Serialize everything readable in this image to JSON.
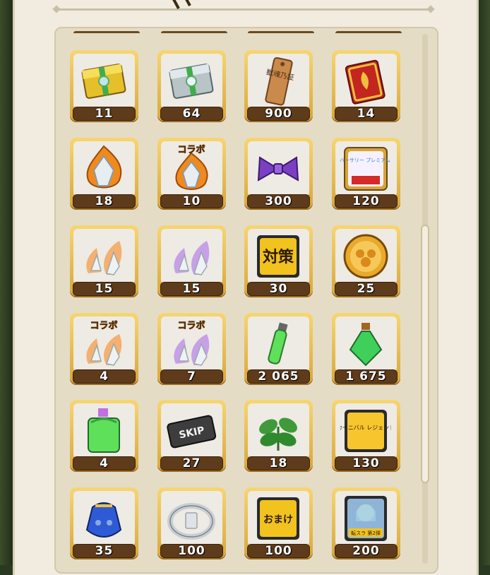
{
  "items": [
    {
      "name": "gold-treasure-chest-icon",
      "count": "11"
    },
    {
      "name": "silver-treasure-chest-icon",
      "count": "64"
    },
    {
      "name": "wooden-tag-icon",
      "count": "900",
      "label": "獣魂乃証"
    },
    {
      "name": "red-book-icon",
      "count": "14"
    },
    {
      "name": "orange-flame-crystal-icon",
      "count": "18"
    },
    {
      "name": "collab-orange-flame-crystal-icon",
      "count": "10",
      "label": "コラボ"
    },
    {
      "name": "purple-bow-icon",
      "count": "300"
    },
    {
      "name": "anniversary-premium-ticket-icon",
      "count": "120",
      "label": "アニバーサリー プレミアム 選抜"
    },
    {
      "name": "orange-crystal-shards-icon",
      "count": "15"
    },
    {
      "name": "purple-crystal-shards-icon",
      "count": "15"
    },
    {
      "name": "countermeasure-card-icon",
      "count": "30",
      "label": "対策"
    },
    {
      "name": "gold-medal-icon",
      "count": "25"
    },
    {
      "name": "collab-orange-crystal-shards-icon",
      "count": "4",
      "label": "コラボ"
    },
    {
      "name": "collab-purple-crystal-shards-icon",
      "count": "7",
      "label": "コラボ"
    },
    {
      "name": "small-green-vial-icon",
      "count": "2 065"
    },
    {
      "name": "green-potion-icon",
      "count": "1 675"
    },
    {
      "name": "large-green-potion-icon",
      "count": "4"
    },
    {
      "name": "skip-ticket-icon",
      "count": "27",
      "label": "SKIP"
    },
    {
      "name": "green-herb-icon",
      "count": "18"
    },
    {
      "name": "carnival-legend-ticket-icon",
      "count": "130",
      "label": "カーニバル レジェンド"
    },
    {
      "name": "blue-pouch-icon",
      "count": "35"
    },
    {
      "name": "silver-ring-icon",
      "count": "100"
    },
    {
      "name": "bonus-card-icon",
      "count": "100",
      "label": "おまけ"
    },
    {
      "name": "character-card-icon",
      "count": "200",
      "label": "転スラ 第2弾"
    }
  ],
  "colors": {
    "panel": "#f1ecdf",
    "tile_frame": "#e8bf55",
    "count_bar": "#5e3b1a",
    "count_text": "#ffffff"
  }
}
